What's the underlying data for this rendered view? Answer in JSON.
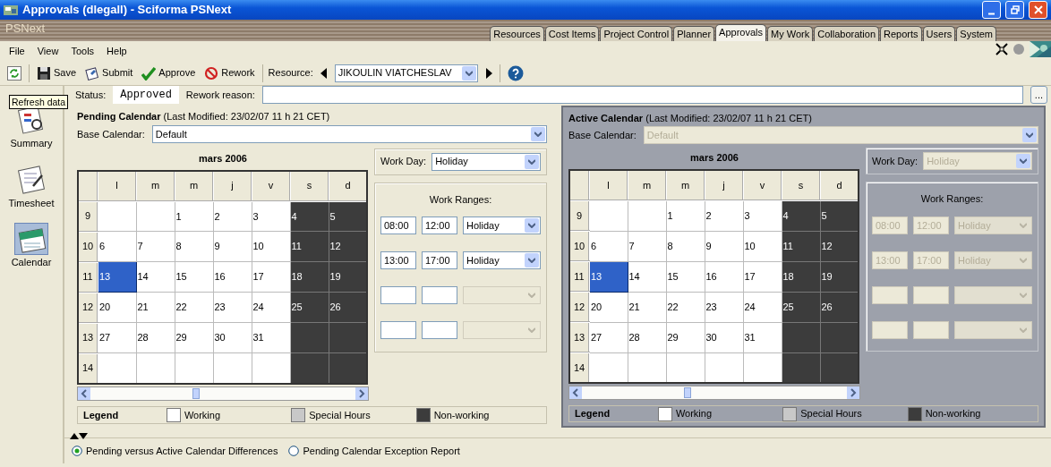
{
  "window": {
    "title": "Approvals (dlegall) - Sciforma PSNext"
  },
  "brand": {
    "logo": "PSNext"
  },
  "module_tabs": [
    {
      "label": "Resources",
      "selected": false
    },
    {
      "label": "Cost Items",
      "selected": false
    },
    {
      "label": "Project Control",
      "selected": false
    },
    {
      "label": "Planner",
      "selected": false
    },
    {
      "label": "Approvals",
      "selected": true
    },
    {
      "label": "My Work",
      "selected": false
    },
    {
      "label": "Collaboration",
      "selected": false
    },
    {
      "label": "Reports",
      "selected": false
    },
    {
      "label": "Users",
      "selected": false
    },
    {
      "label": "System",
      "selected": false
    }
  ],
  "menu": [
    "File",
    "View",
    "Tools",
    "Help"
  ],
  "toolbar": {
    "buttons": [
      {
        "kind": "save",
        "label": "Save"
      },
      {
        "kind": "submit",
        "label": "Submit"
      },
      {
        "kind": "approve",
        "label": "Approve"
      },
      {
        "kind": "rework",
        "label": "Rework"
      }
    ],
    "resource_label": "Resource:",
    "resource": "JIKOULIN VIATCHESLAV"
  },
  "tooltip": "Refresh data",
  "status": {
    "label": "Status:",
    "value": "Approved",
    "reason_label": "Rework reason:",
    "browse": "..."
  },
  "sidebar": {
    "items": [
      {
        "kind": "summary",
        "label": "Summary",
        "selected": false
      },
      {
        "kind": "timesheet",
        "label": "Timesheet",
        "selected": false
      },
      {
        "kind": "calendar",
        "label": "Calendar",
        "selected": true
      }
    ]
  },
  "calendars": [
    {
      "title": "Pending Calendar",
      "subtitle": "(Last Modified: 23/02/07 11 h 21 CET)",
      "disabled": false,
      "base_label": "Base Calendar:",
      "base_value": "Default",
      "month": "mars 2006",
      "weekdays": [
        "l",
        "m",
        "m",
        "j",
        "v",
        "s",
        "d"
      ],
      "weeks": [
        {
          "number": "9",
          "days": [
            {
              "non_working": false,
              "selected": false
            },
            {
              "non_working": false,
              "selected": false
            },
            {
              "day": "1",
              "non_working": false,
              "selected": false
            },
            {
              "day": "2",
              "non_working": false,
              "selected": false
            },
            {
              "day": "3",
              "non_working": false,
              "selected": false
            },
            {
              "day": "4",
              "non_working": true,
              "selected": false
            },
            {
              "day": "5",
              "non_working": true,
              "selected": false
            }
          ]
        },
        {
          "number": "10",
          "days": [
            {
              "day": "6",
              "non_working": false,
              "selected": false
            },
            {
              "day": "7",
              "non_working": false,
              "selected": false
            },
            {
              "day": "8",
              "non_working": false,
              "selected": false
            },
            {
              "day": "9",
              "non_working": false,
              "selected": false
            },
            {
              "day": "10",
              "non_working": false,
              "selected": false
            },
            {
              "day": "11",
              "non_working": true,
              "selected": false
            },
            {
              "day": "12",
              "non_working": true,
              "selected": false
            }
          ]
        },
        {
          "number": "11",
          "days": [
            {
              "day": "13",
              "non_working": false,
              "selected": true
            },
            {
              "day": "14",
              "non_working": false,
              "selected": false
            },
            {
              "day": "15",
              "non_working": false,
              "selected": false
            },
            {
              "day": "16",
              "non_working": false,
              "selected": false
            },
            {
              "day": "17",
              "non_working": false,
              "selected": false
            },
            {
              "day": "18",
              "non_working": true,
              "selected": false
            },
            {
              "day": "19",
              "non_working": true,
              "selected": false
            }
          ]
        },
        {
          "number": "12",
          "days": [
            {
              "day": "20",
              "non_working": false,
              "selected": false
            },
            {
              "day": "21",
              "non_working": false,
              "selected": false
            },
            {
              "day": "22",
              "non_working": false,
              "selected": false
            },
            {
              "day": "23",
              "non_working": false,
              "selected": false
            },
            {
              "day": "24",
              "non_working": false,
              "selected": false
            },
            {
              "day": "25",
              "non_working": true,
              "selected": false
            },
            {
              "day": "26",
              "non_working": true,
              "selected": false
            }
          ]
        },
        {
          "number": "13",
          "days": [
            {
              "day": "27",
              "non_working": false,
              "selected": false
            },
            {
              "day": "28",
              "non_working": false,
              "selected": false
            },
            {
              "day": "29",
              "non_working": false,
              "selected": false
            },
            {
              "day": "30",
              "non_working": false,
              "selected": false
            },
            {
              "day": "31",
              "non_working": false,
              "selected": false
            },
            {
              "non_working": true,
              "selected": false
            },
            {
              "non_working": true,
              "selected": false
            }
          ]
        },
        {
          "number": "14",
          "days": [
            {
              "non_working": false,
              "selected": false
            },
            {
              "non_working": false,
              "selected": false
            },
            {
              "non_working": false,
              "selected": false
            },
            {
              "non_working": false,
              "selected": false
            },
            {
              "non_working": false,
              "selected": false
            },
            {
              "non_working": true,
              "selected": false
            },
            {
              "non_working": true,
              "selected": false
            }
          ]
        }
      ],
      "workday_label": "Work Day:",
      "workday": "Holiday",
      "ranges_title": "Work Ranges:",
      "ranges": [
        {
          "start": "08:00",
          "end": "12:00",
          "type": "Holiday",
          "disabled": false
        },
        {
          "start": "13:00",
          "end": "17:00",
          "type": "Holiday",
          "disabled": false
        },
        {
          "disabled": true
        },
        {
          "disabled": true
        }
      ],
      "legend": {
        "label": "Legend",
        "items": [
          {
            "label": "Working",
            "color": "#ffffff"
          },
          {
            "label": "Special Hours",
            "color": "#c8c8c8"
          },
          {
            "label": "Non-working",
            "color": "#3c3c3c"
          }
        ]
      }
    },
    {
      "title": "Active Calendar",
      "subtitle": "(Last Modified: 23/02/07 11 h 21 CET)",
      "disabled": true,
      "base_label": "Base Calendar:",
      "base_value": "Default",
      "month": "mars 2006",
      "weekdays": [
        "l",
        "m",
        "m",
        "j",
        "v",
        "s",
        "d"
      ],
      "weeks": [
        {
          "number": "9",
          "days": [
            {
              "non_working": false,
              "selected": false
            },
            {
              "non_working": false,
              "selected": false
            },
            {
              "day": "1",
              "non_working": false,
              "selected": false
            },
            {
              "day": "2",
              "non_working": false,
              "selected": false
            },
            {
              "day": "3",
              "non_working": false,
              "selected": false
            },
            {
              "day": "4",
              "non_working": true,
              "selected": false
            },
            {
              "day": "5",
              "non_working": true,
              "selected": false
            }
          ]
        },
        {
          "number": "10",
          "days": [
            {
              "day": "6",
              "non_working": false,
              "selected": false
            },
            {
              "day": "7",
              "non_working": false,
              "selected": false
            },
            {
              "day": "8",
              "non_working": false,
              "selected": false
            },
            {
              "day": "9",
              "non_working": false,
              "selected": false
            },
            {
              "day": "10",
              "non_working": false,
              "selected": false
            },
            {
              "day": "11",
              "non_working": true,
              "selected": false
            },
            {
              "day": "12",
              "non_working": true,
              "selected": false
            }
          ]
        },
        {
          "number": "11",
          "days": [
            {
              "day": "13",
              "non_working": false,
              "selected": true
            },
            {
              "day": "14",
              "non_working": false,
              "selected": false
            },
            {
              "day": "15",
              "non_working": false,
              "selected": false
            },
            {
              "day": "16",
              "non_working": false,
              "selected": false
            },
            {
              "day": "17",
              "non_working": false,
              "selected": false
            },
            {
              "day": "18",
              "non_working": true,
              "selected": false
            },
            {
              "day": "19",
              "non_working": true,
              "selected": false
            }
          ]
        },
        {
          "number": "12",
          "days": [
            {
              "day": "20",
              "non_working": false,
              "selected": false
            },
            {
              "day": "21",
              "non_working": false,
              "selected": false
            },
            {
              "day": "22",
              "non_working": false,
              "selected": false
            },
            {
              "day": "23",
              "non_working": false,
              "selected": false
            },
            {
              "day": "24",
              "non_working": false,
              "selected": false
            },
            {
              "day": "25",
              "non_working": true,
              "selected": false
            },
            {
              "day": "26",
              "non_working": true,
              "selected": false
            }
          ]
        },
        {
          "number": "13",
          "days": [
            {
              "day": "27",
              "non_working": false,
              "selected": false
            },
            {
              "day": "28",
              "non_working": false,
              "selected": false
            },
            {
              "day": "29",
              "non_working": false,
              "selected": false
            },
            {
              "day": "30",
              "non_working": false,
              "selected": false
            },
            {
              "day": "31",
              "non_working": false,
              "selected": false
            },
            {
              "non_working": true,
              "selected": false
            },
            {
              "non_working": true,
              "selected": false
            }
          ]
        },
        {
          "number": "14",
          "days": [
            {
              "non_working": false,
              "selected": false
            },
            {
              "non_working": false,
              "selected": false
            },
            {
              "non_working": false,
              "selected": false
            },
            {
              "non_working": false,
              "selected": false
            },
            {
              "non_working": false,
              "selected": false
            },
            {
              "non_working": true,
              "selected": false
            },
            {
              "non_working": true,
              "selected": false
            }
          ]
        }
      ],
      "workday_label": "Work Day:",
      "workday": "Holiday",
      "ranges_title": "Work Ranges:",
      "ranges": [
        {
          "start": "08:00",
          "end": "12:00",
          "type": "Holiday",
          "disabled": true
        },
        {
          "start": "13:00",
          "end": "17:00",
          "type": "Holiday",
          "disabled": true
        },
        {
          "disabled": true
        },
        {
          "disabled": true
        }
      ],
      "legend": {
        "label": "Legend",
        "items": [
          {
            "label": "Working",
            "color": "#ffffff"
          },
          {
            "label": "Special Hours",
            "color": "#c8c8c8"
          },
          {
            "label": "Non-working",
            "color": "#3c3c3c"
          }
        ]
      }
    }
  ],
  "report_options": [
    {
      "label": "Pending versus Active Calendar Differences",
      "selected": true
    },
    {
      "label": "Pending Calendar Exception Report",
      "selected": false
    }
  ]
}
